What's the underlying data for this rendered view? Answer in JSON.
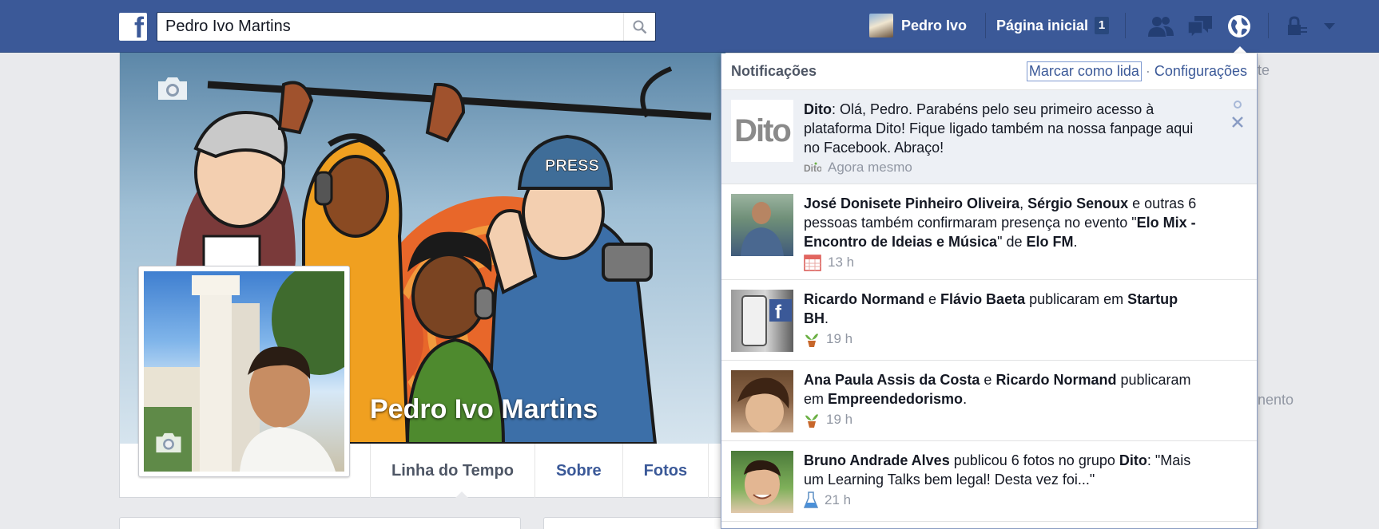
{
  "topbar": {
    "search_value": "Pedro Ivo Martins",
    "profile_name": "Pedro Ivo",
    "home_label": "Página inicial",
    "home_count": "1"
  },
  "profile": {
    "name": "Pedro Ivo Martins",
    "tabs": [
      "Linha do Tempo",
      "Sobre",
      "Fotos"
    ]
  },
  "right_peek": {
    "top": "te",
    "middle": "nento"
  },
  "notifications": {
    "title": "Notificações",
    "mark_read": "Marcar como lida",
    "separator": "·",
    "settings": "Configurações",
    "dito_logo": "Dito",
    "items": [
      {
        "parts": [
          {
            "t": "Dito",
            "b": true
          },
          {
            "t": ": Olá, Pedro. Parabéns pelo seu primeiro acesso à plataforma Dito! Fique ligado também na nossa fanpage aqui no Facebook. Abraço!",
            "b": false
          }
        ],
        "time": "Agora mesmo",
        "icon": "dito-app-icon",
        "unread": true
      },
      {
        "parts": [
          {
            "t": "José Donisete Pinheiro Oliveira",
            "b": true
          },
          {
            "t": ", ",
            "b": false
          },
          {
            "t": "Sérgio Senoux",
            "b": true
          },
          {
            "t": " e outras 6 pessoas também confirmaram presença no evento \"",
            "b": false
          },
          {
            "t": "Elo Mix - Encontro de Ideias e Música",
            "b": true
          },
          {
            "t": "\" de ",
            "b": false
          },
          {
            "t": "Elo FM",
            "b": true
          },
          {
            "t": ".",
            "b": false
          }
        ],
        "time": "13 h",
        "icon": "calendar-icon",
        "unread": false
      },
      {
        "parts": [
          {
            "t": "Ricardo Normand",
            "b": true
          },
          {
            "t": " e ",
            "b": false
          },
          {
            "t": "Flávio Baeta",
            "b": true
          },
          {
            "t": " publicaram em ",
            "b": false
          },
          {
            "t": "Startup BH",
            "b": true
          },
          {
            "t": ".",
            "b": false
          }
        ],
        "time": "19 h",
        "icon": "plant-icon",
        "unread": false
      },
      {
        "parts": [
          {
            "t": "Ana Paula Assis da Costa",
            "b": true
          },
          {
            "t": " e ",
            "b": false
          },
          {
            "t": "Ricardo Normand",
            "b": true
          },
          {
            "t": " publicaram em ",
            "b": false
          },
          {
            "t": "Empreendedorismo",
            "b": true
          },
          {
            "t": ".",
            "b": false
          }
        ],
        "time": "19 h",
        "icon": "plant-icon",
        "unread": false
      },
      {
        "parts": [
          {
            "t": "Bruno Andrade Alves",
            "b": true
          },
          {
            "t": " publicou 6 fotos no grupo ",
            "b": false
          },
          {
            "t": "Dito",
            "b": true
          },
          {
            "t": ": \"Mais um Learning Talks bem legal! Desta vez foi...\"",
            "b": false
          }
        ],
        "time": "21 h",
        "icon": "flask-icon",
        "unread": false
      }
    ]
  }
}
